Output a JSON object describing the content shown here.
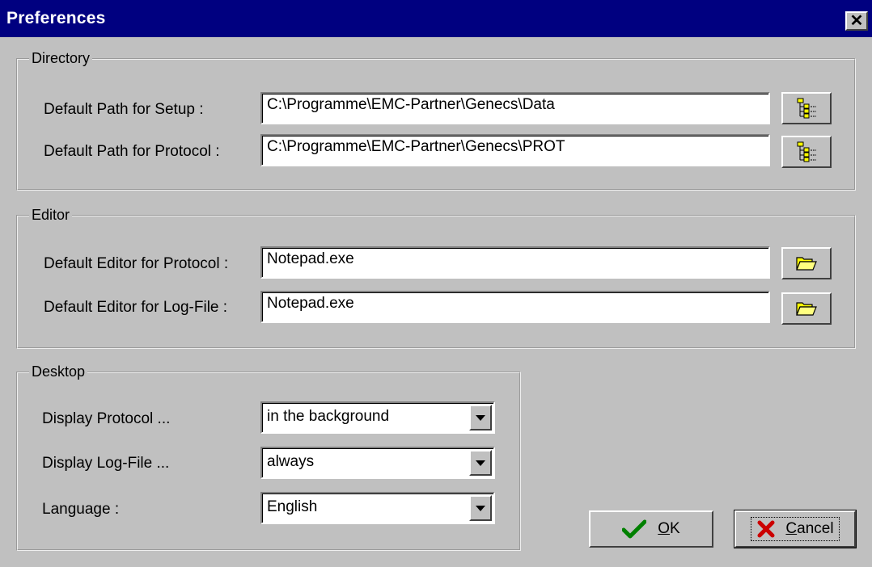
{
  "window": {
    "title": "Preferences",
    "close_label": "✕"
  },
  "directory": {
    "group_label": "Directory",
    "setup_label": "Default Path for Setup :",
    "setup_value": "C:\\Programme\\EMC-Partner\\Genecs\\Data",
    "protocol_label": "Default Path for Protocol :",
    "protocol_value": "C:\\Programme\\EMC-Partner\\Genecs\\PROT",
    "browse_icon": "folder-tree-icon"
  },
  "editor": {
    "group_label": "Editor",
    "protocol_label": "Default Editor for Protocol :",
    "protocol_value": "Notepad.exe",
    "logfile_label": "Default Editor for Log-File :",
    "logfile_value": "Notepad.exe",
    "browse_icon": "open-folder-icon"
  },
  "desktop": {
    "group_label": "Desktop",
    "display_protocol_label": "Display Protocol ...",
    "display_protocol_value": "in the background",
    "display_logfile_label": "Display Log-File ...",
    "display_logfile_value": "always",
    "language_label": "Language :",
    "language_value": "English"
  },
  "buttons": {
    "ok_mnemonic": "O",
    "ok_rest": "K",
    "cancel_mnemonic": "C",
    "cancel_rest": "ancel",
    "ok_icon": "checkmark-icon",
    "cancel_icon": "red-x-icon"
  },
  "colors": {
    "title_bar": "#000080",
    "face": "#c0c0c0",
    "check": "#008000",
    "cross": "#cc0000"
  }
}
